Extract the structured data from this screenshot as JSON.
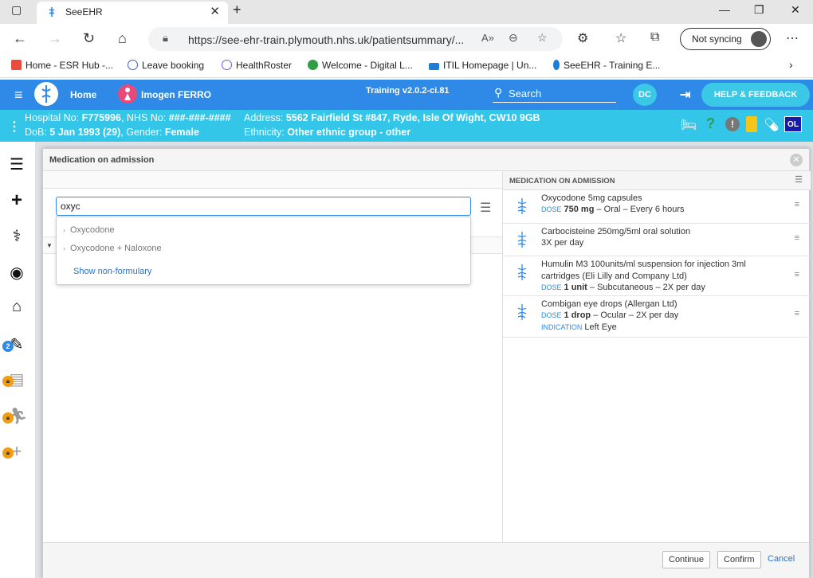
{
  "browser": {
    "tab_title": "SeeEHR",
    "url": "https://see-ehr-train.plymouth.nhs.uk/patientsummary/...",
    "sync_label": "Not syncing",
    "bookmarks": [
      {
        "label": "Home - ESR Hub -...",
        "color": "#e74c3c"
      },
      {
        "label": "Leave booking",
        "color": "#3b5bdb"
      },
      {
        "label": "HealthRoster",
        "color": "#7950f2"
      },
      {
        "label": "Welcome - Digital L...",
        "color": "#2f9e44"
      },
      {
        "label": "ITIL Homepage | Un...",
        "color": "#1c7ed6"
      },
      {
        "label": "SeeEHR - Training E...",
        "color": "#1c7ed6"
      }
    ]
  },
  "app": {
    "home_label": "Home",
    "patient_name": "Imogen FERRO",
    "version": "Training v2.0.2-ci.81",
    "search_label": "Search",
    "user_initials": "DC",
    "help_label": "HELP & FEEDBACK",
    "ol_badge": "OL"
  },
  "patient": {
    "hospital_no_label": "Hospital No:",
    "hospital_no": "F775996",
    "nhs_no_label": "NHS No:",
    "nhs_no": "###-###-####",
    "address_label": "Address:",
    "address": "5562 Fairfield St #847, Ryde, Isle Of Wight, CW10 9GB",
    "dob_label": "DoB:",
    "dob": "5 Jan 1993 (29)",
    "gender_label": "Gender:",
    "gender": "Female",
    "ethnicity_label": "Ethnicity:",
    "ethnicity": "Other ethnic group - other"
  },
  "sidebar": {
    "badge_count": "2"
  },
  "modal": {
    "title": "Medication on admission",
    "search_value": "oxyc",
    "suggestions": [
      "Oxycodone",
      "Oxycodone + Naloxone"
    ],
    "show_non_formulary": "Show non-formulary",
    "right_header": "MEDICATION ON ADMISSION",
    "medications": [
      {
        "name": "Oxycodone 5mg capsules",
        "dose_label": "DOSE",
        "dose": "750 mg",
        "rest": "– Oral – Every 6 hours"
      },
      {
        "name": "Carbocisteine 250mg/5ml oral solution",
        "plain": "3X per day"
      },
      {
        "name": "Humulin M3 100units/ml suspension for injection 3ml cartridges (Eli Lilly and Company Ltd)",
        "dose_label": "DOSE",
        "dose": "1 unit",
        "rest": "– Subcutaneous – 2X per day"
      },
      {
        "name": "Combigan eye drops (Allergan Ltd)",
        "dose_label": "DOSE",
        "dose": "1 drop",
        "rest": "– Ocular – 2X per day",
        "indication_label": "INDICATION",
        "indication": "Left Eye"
      }
    ],
    "continue_label": "Continue",
    "confirm_label": "Confirm",
    "cancel_label": "Cancel"
  },
  "colors": {
    "header_blue": "#2e8ae6",
    "banner_cyan": "#33c6e8",
    "accent_cyan": "#3ac8e6",
    "lock_orange": "#f39c12"
  }
}
